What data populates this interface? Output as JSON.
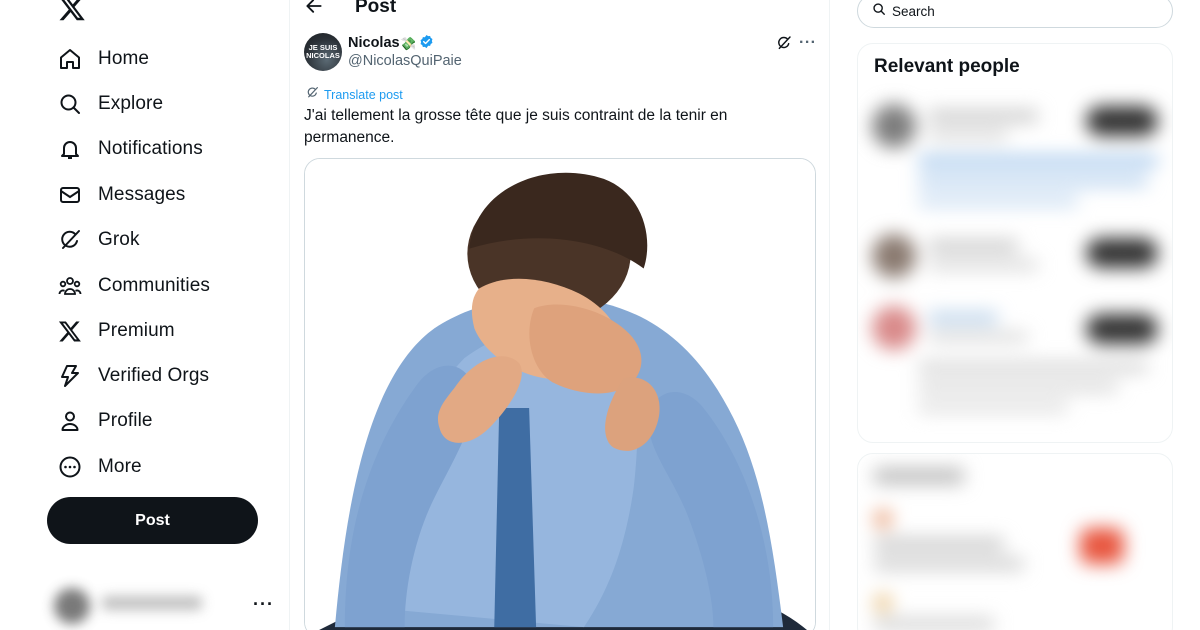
{
  "nav": {
    "items": [
      {
        "label": "Home",
        "icon": "home-icon"
      },
      {
        "label": "Explore",
        "icon": "search-icon"
      },
      {
        "label": "Notifications",
        "icon": "bell-icon"
      },
      {
        "label": "Messages",
        "icon": "envelope-icon"
      },
      {
        "label": "Grok",
        "icon": "grok-icon"
      },
      {
        "label": "Communities",
        "icon": "people-icon"
      },
      {
        "label": "Premium",
        "icon": "x-logo-icon"
      },
      {
        "label": "Verified Orgs",
        "icon": "lightning-icon"
      },
      {
        "label": "Profile",
        "icon": "person-icon"
      },
      {
        "label": "More",
        "icon": "more-circle-icon"
      }
    ],
    "post_button": "Post",
    "account_more": "···"
  },
  "header": {
    "title": "Post"
  },
  "post": {
    "author_name": "Nicolas",
    "author_emoji": "💸",
    "author_handle": "@NicolasQuiPaie",
    "avatar_text_line1": "JE SUIS",
    "avatar_text_line2": "NICOLAS",
    "more": "···",
    "translate_label": "Translate post",
    "text": "J'ai tellement la grosse tête que je suis contraint de la tenir en permanence.",
    "media_description_icon": "photo-man-holding-head",
    "verified_color": "#1d9bf0"
  },
  "right": {
    "search_placeholder": "Search",
    "relevant_title": "Relevant people"
  },
  "colors": {
    "text": "#0f1419",
    "muted": "#536471",
    "accent": "#1d9bf0",
    "border": "#eff3f4"
  }
}
